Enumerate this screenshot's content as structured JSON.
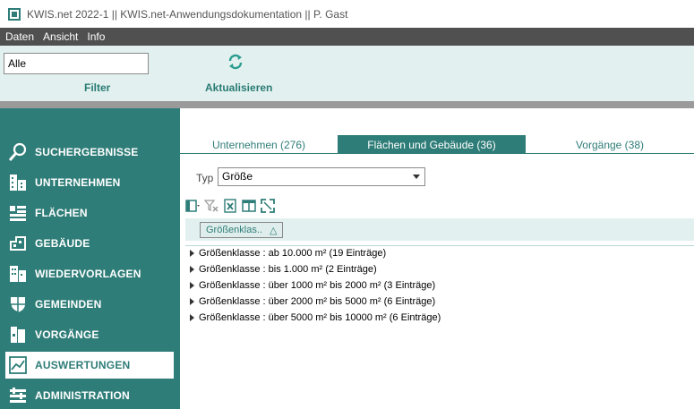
{
  "window": {
    "title": "KWIS.net 2022-1 || KWIS.net-Anwendungsdokumentation || P. Gast"
  },
  "menu": {
    "items": [
      "Daten",
      "Ansicht",
      "Info"
    ]
  },
  "toolbar": {
    "filter_value": "Alle",
    "filter_label": "Filter",
    "refresh_label": "Aktualisieren"
  },
  "sidebar": {
    "items": [
      {
        "label": "SUCHERGEBNISSE",
        "icon": "search-icon"
      },
      {
        "label": "UNTERNEHMEN",
        "icon": "company-icon"
      },
      {
        "label": "FLÄCHEN",
        "icon": "areas-icon"
      },
      {
        "label": "GEBÄUDE",
        "icon": "building-icon"
      },
      {
        "label": "WIEDERVORLAGEN",
        "icon": "resubmission-icon"
      },
      {
        "label": "GEMEINDEN",
        "icon": "municipality-shield-icon"
      },
      {
        "label": "VORGÄNGE",
        "icon": "processes-icon"
      },
      {
        "label": "AUSWERTUNGEN",
        "icon": "chart-icon",
        "active": true
      },
      {
        "label": "ADMINISTRATION",
        "icon": "settings-sliders-icon"
      }
    ]
  },
  "tabs": [
    {
      "label": "Unternehmen (276)"
    },
    {
      "label": "Flächen und Gebäude (36)",
      "active": true
    },
    {
      "label": "Vorgänge (38)"
    }
  ],
  "typ": {
    "label": "Typ",
    "value": "Größe"
  },
  "group_panel": {
    "chip_label": "Größenklas..",
    "sort_glyph": "△"
  },
  "rows": [
    "Größenklasse : ab 10.000 m² (19 Einträge)",
    "Größenklasse : bis 1.000 m² (2 Einträge)",
    "Größenklasse : über 1000 m² bis 2000 m² (3 Einträge)",
    "Größenklasse : über 2000 m² bis 5000 m² (6 Einträge)",
    "Größenklasse : über 5000 m² bis 10000 m² (6 Einträge)"
  ],
  "colors": {
    "accent": "#2f7d78",
    "toolbar_bg": "#e2f1ef",
    "menubar_bg": "#505050"
  }
}
